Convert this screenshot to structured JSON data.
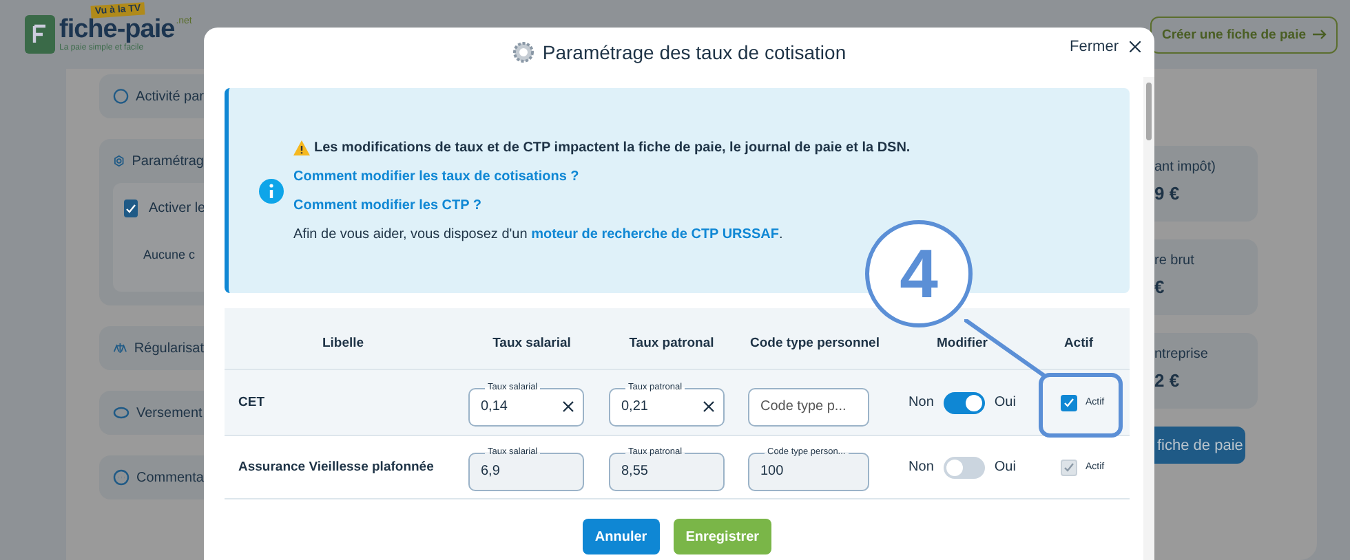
{
  "background": {
    "logo": {
      "badge": "Vu à la TV",
      "name": "fiche-paie",
      "suffix": ".net",
      "tagline": "La paie simple et facile"
    },
    "create_button": "Créer une fiche de paie",
    "left_cards": [
      {
        "label": "Activité par"
      },
      {
        "label": "Paramétrag",
        "checkbox_label": "Activer le",
        "checked": true,
        "note": "Aucune c"
      },
      {
        "label": "Régularisat"
      },
      {
        "label": "Versement"
      },
      {
        "label": "Commenta"
      }
    ],
    "right_cards": [
      {
        "label": "ant impôt)",
        "value": "9 €"
      },
      {
        "label": "re brut",
        "value": "€"
      },
      {
        "label": "ntreprise",
        "value": "2 €"
      }
    ],
    "right_button": "fiche de paie"
  },
  "modal": {
    "title": "Paramétrage des taux de cotisation",
    "close_label": "Fermer",
    "info": {
      "warning": "Les modifications de taux et de CTP impactent la fiche de paie, le journal de paie et la DSN.",
      "links": [
        "Comment modifier les taux de cotisations ?",
        "Comment modifier les CTP ?"
      ],
      "help_prefix": "Afin de vous aider, vous disposez d'un ",
      "help_link": "moteur de recherche de CTP URSSAF",
      "help_suffix": "."
    },
    "columns": [
      "Libelle",
      "Taux salarial",
      "Taux patronal",
      "Code type personnel",
      "Modifier",
      "Actif"
    ],
    "rows": [
      {
        "label": "CET",
        "editable": true,
        "modify_on": true,
        "active": true,
        "off_label": "Non",
        "on_label": "Oui",
        "active_label": "Actif",
        "fields": [
          {
            "label": "Taux salarial",
            "value": "0,14"
          },
          {
            "label": "Taux patronal",
            "value": "0,21"
          },
          {
            "placeholder": "Code type p..."
          }
        ]
      },
      {
        "label": "Assurance Vieillesse plafonnée",
        "editable": false,
        "modify_on": false,
        "active": true,
        "off_label": "Non",
        "on_label": "Oui",
        "active_label": "Actif",
        "fields": [
          {
            "label": "Taux salarial",
            "value": "6,9"
          },
          {
            "label": "Taux patronal",
            "value": "8,55"
          },
          {
            "label": "Code type person...",
            "value": "100"
          }
        ]
      }
    ],
    "cancel": "Annuler",
    "save": "Enregistrer"
  },
  "annotation": {
    "label": "4"
  }
}
